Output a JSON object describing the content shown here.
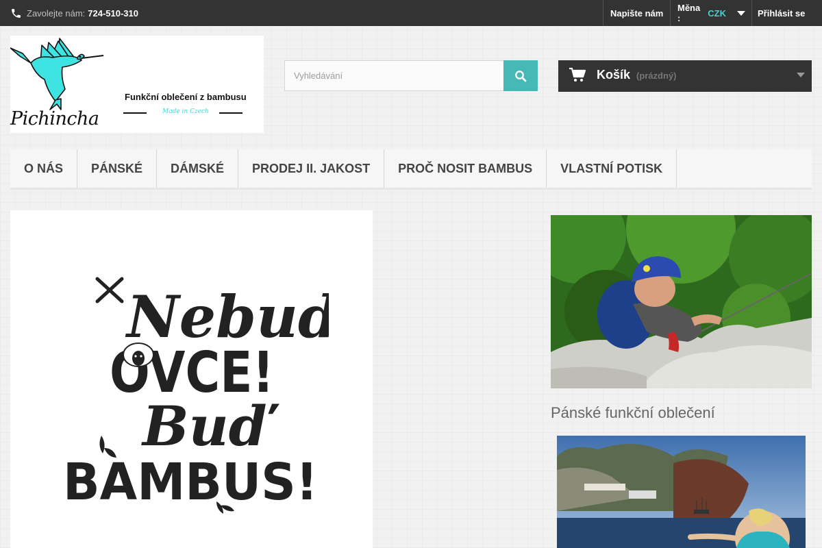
{
  "topbar": {
    "phone_label": "Zavolejte nám:",
    "phone_number": "724-510-310",
    "phone_icon": "phone-icon",
    "contact_label": "Napište nám",
    "currency_label": "Měna :",
    "currency_value": "CZK",
    "login_label": "Přihlásit se",
    "colors": {
      "bar": "#333333",
      "accent": "#46d3d1"
    }
  },
  "logo": {
    "name": "Pichincha",
    "tagline": "Funkční oblečení z bambusu",
    "made_in": "Made in Czech",
    "bird_color": "#3ee4e2"
  },
  "search": {
    "placeholder": "Vyhledávání",
    "value": "",
    "button_icon": "search-icon",
    "button_color": "#46b8b6"
  },
  "cart": {
    "title": "Košík",
    "status": "(prázdný)",
    "icon": "cart-icon"
  },
  "menu": {
    "items": [
      {
        "label": "O NÁS"
      },
      {
        "label": "PÁNSKÉ"
      },
      {
        "label": "DÁMSKÉ"
      },
      {
        "label": "PRODEJ II. JAKOST"
      },
      {
        "label": "PROČ NOSIT BAMBUS"
      },
      {
        "label": "VLASTNÍ POTISK"
      }
    ]
  },
  "slider": {
    "line1": "Nebuď",
    "line2": "OVCE!",
    "line3": "Buď",
    "line4": "BAMBUS!"
  },
  "sidebar": {
    "category_title": "Pánské funkční oblečení"
  }
}
